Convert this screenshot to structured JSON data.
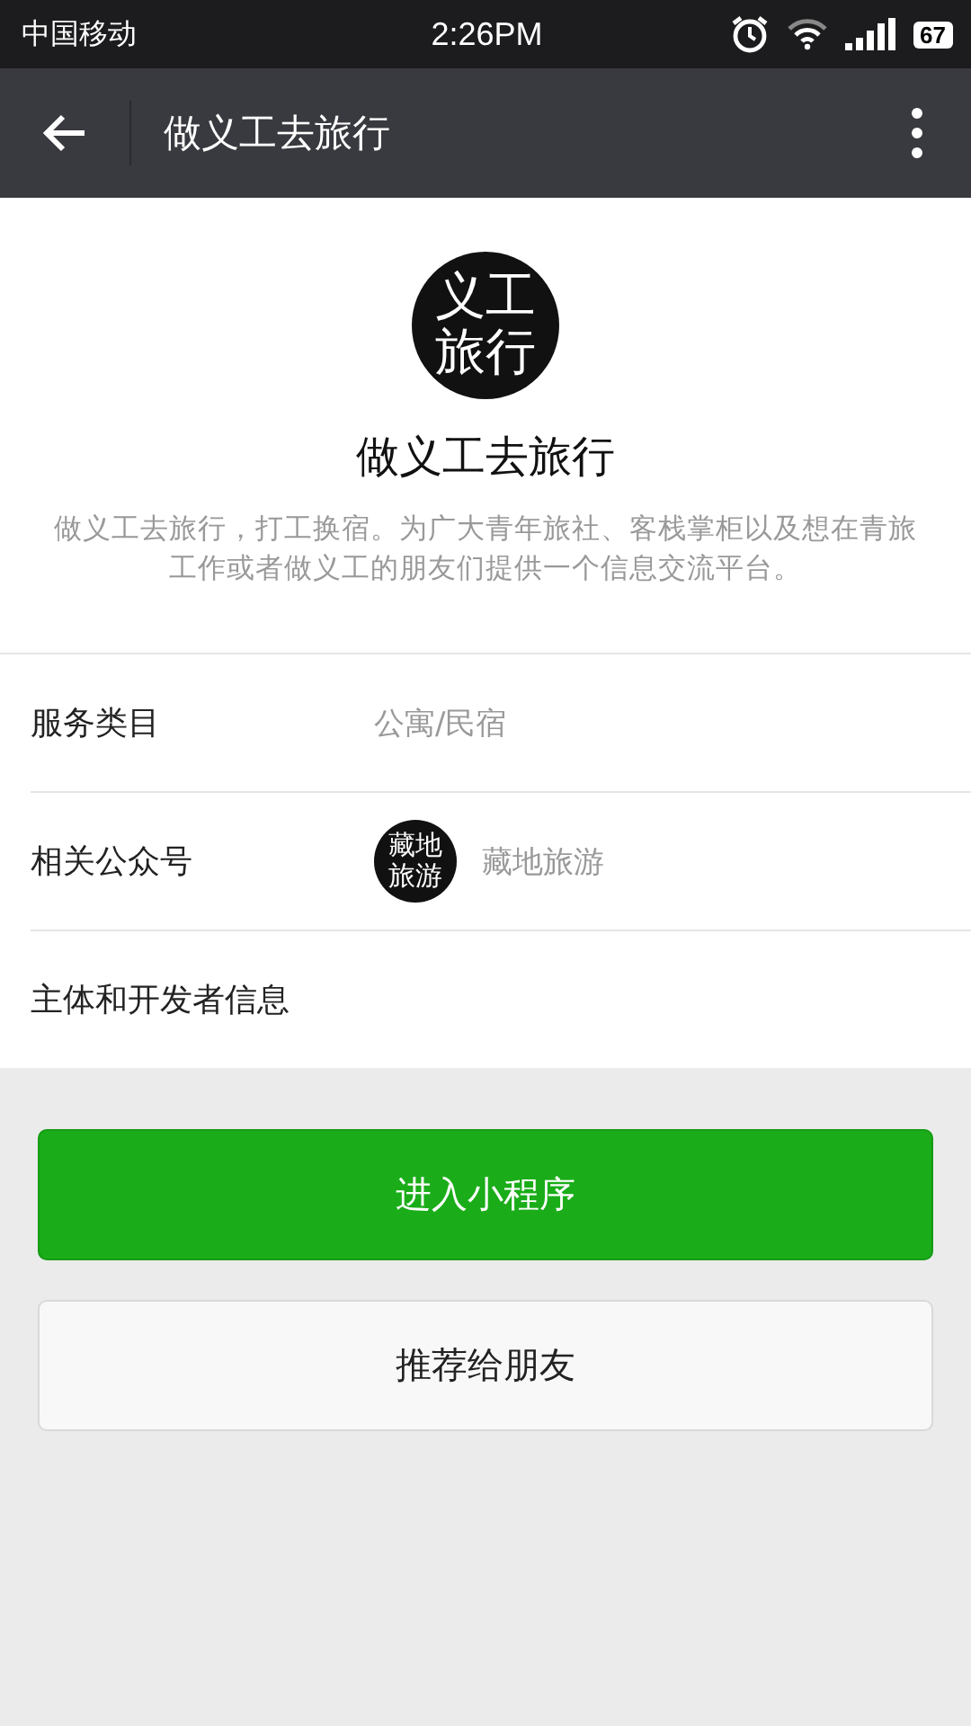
{
  "status_bar": {
    "carrier": "中国移动",
    "time": "2:26PM",
    "battery": "67"
  },
  "nav": {
    "title": "做义工去旅行"
  },
  "profile": {
    "logo_text": "义工旅行",
    "name": "做义工去旅行",
    "description": "做义工去旅行，打工换宿。为广大青年旅社、客栈掌柜以及想在青旅工作或者做义工的朋友们提供一个信息交流平台。"
  },
  "info_rows": [
    {
      "kind": "text",
      "label": "服务类目",
      "value": "公寓/民宿"
    },
    {
      "kind": "account",
      "label": "相关公众号",
      "avatar_text": "藏地旅游",
      "value": "藏地旅游"
    },
    {
      "kind": "plain",
      "label": "主体和开发者信息"
    }
  ],
  "buttons": [
    {
      "kind": "primary",
      "label": "进入小程序"
    },
    {
      "kind": "secondary",
      "label": "推荐给朋友"
    }
  ]
}
